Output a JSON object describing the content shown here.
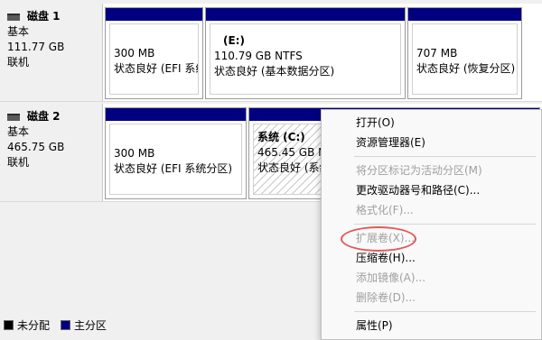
{
  "disks": [
    {
      "name": "磁盘 1",
      "type": "基本",
      "size": "111.77 GB",
      "status": "联机",
      "partitions": [
        {
          "title": "",
          "size": "300 MB",
          "status": "状态良好 (EFI 系统"
        },
        {
          "title": "(E:)",
          "size": "110.79 GB NTFS",
          "status": "状态良好 (基本数据分区)"
        },
        {
          "title": "",
          "size": "707 MB",
          "status": "状态良好 (恢复分区)"
        }
      ]
    },
    {
      "name": "磁盘 2",
      "type": "基本",
      "size": "465.75 GB",
      "status": "联机",
      "partitions": [
        {
          "title": "",
          "size": "300 MB",
          "status": "状态良好 (EFI 系统分区)"
        },
        {
          "title": "系统  (C:)",
          "size": "465.45 GB N",
          "status": "状态良好 (系统"
        }
      ]
    }
  ],
  "legend": [
    {
      "label": "未分配",
      "color": "#000000"
    },
    {
      "label": "主分区",
      "color": "#000080"
    }
  ],
  "context_menu": {
    "items": [
      {
        "label": "打开(O)",
        "enabled": true
      },
      {
        "label": "资源管理器(E)",
        "enabled": true
      },
      {
        "label": "将分区标记为活动分区(M)",
        "enabled": false
      },
      {
        "label": "更改驱动器号和路径(C)...",
        "enabled": true
      },
      {
        "label": "格式化(F)...",
        "enabled": false
      },
      {
        "label": "扩展卷(X)...",
        "enabled": false
      },
      {
        "label": "压缩卷(H)...",
        "enabled": true
      },
      {
        "label": "添加镜像(A)...",
        "enabled": false
      },
      {
        "label": "删除卷(D)...",
        "enabled": false
      },
      {
        "label": "属性(P)",
        "enabled": true
      }
    ]
  },
  "colors": {
    "primary_partition_bar": "#000080",
    "highlight_oval": "#e05a5a"
  }
}
